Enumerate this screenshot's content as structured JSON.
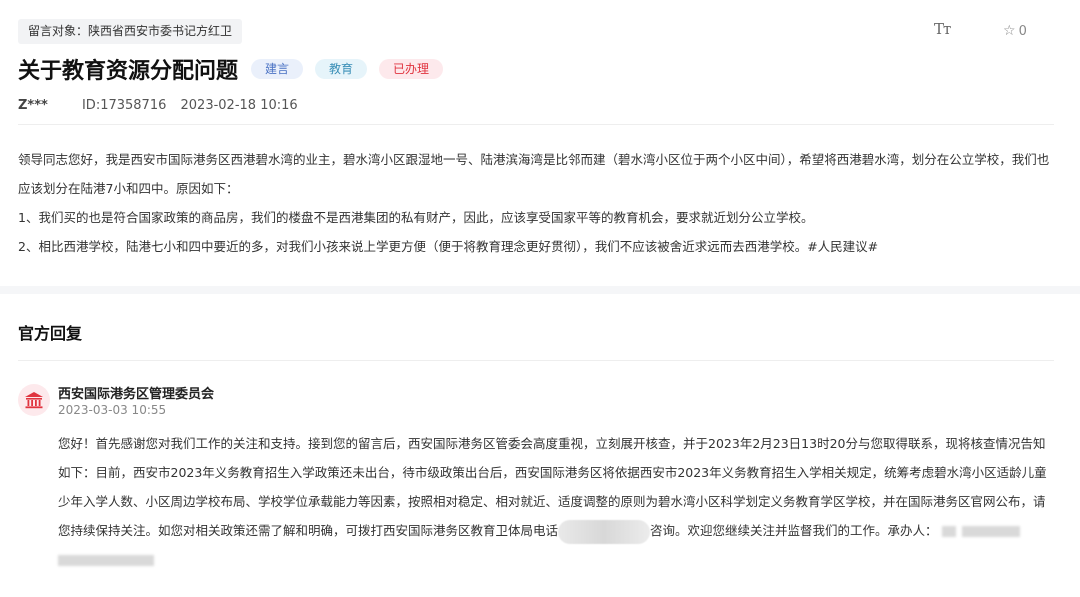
{
  "header": {
    "recipient": "留言对象：陕西省西安市委书记方红卫",
    "font_size_icon": "Tт",
    "star_count": "0"
  },
  "post": {
    "title": "关于教育资源分配问题",
    "tags": [
      "建言",
      "教育",
      "已办理"
    ],
    "author": "Z***",
    "id_text": "ID:17358716",
    "date": "2023-02-18 10:16",
    "paragraphs": [
      "领导同志您好，我是西安市国际港务区西港碧水湾的业主，碧水湾小区跟湿地一号、陆港滨海湾是比邻而建（碧水湾小区位于两个小区中间），希望将西港碧水湾，划分在公立学校，我们也应该划分在陆港7小和四中。原因如下：",
      "1、我们买的也是符合国家政策的商品房，我们的楼盘不是西港集团的私有财产，因此，应该享受国家平等的教育机会，要求就近划分公立学校。",
      "2、相比西港学校，陆港七小和四中要近的多，对我们小孩来说上学更方便（便于将教育理念更好贯彻），我们不应该被舍近求远而去西港学校。#人民建议#"
    ]
  },
  "reply": {
    "section_title": "官方回复",
    "org_name": "西安国际港务区管理委员会",
    "time": "2023-03-03 10:55",
    "text_before_phone": "您好！首先感谢您对我们工作的关注和支持。接到您的留言后，西安国际港务区管委会高度重视，立刻展开核查，并于2023年2月23日13时20分与您取得联系，现将核查情况告知如下：目前，西安市2023年义务教育招生入学政策还未出台，待市级政策出台后，西安国际港务区将依据西安市2023年义务教育招生入学相关规定，统筹考虑碧水湾小区适龄儿童少年入学人数、小区周边学校布局、学校学位承载能力等因素，按照相对稳定、相对就近、适度调整的原则为碧水湾小区科学划定义务教育学区学校，并在国际港务区官网公布，请您持续保持关注。如您对相关政策还需了解和明确，可拨打西安国际港务区教育卫体局电话",
    "text_after_phone": "咨询。欢迎您继续关注并监督我们的工作。承办人："
  },
  "icons": {
    "star": "star-outline-icon",
    "org": "government-building-icon"
  },
  "colors": {
    "tag_suggest": "#4a72c4",
    "tag_edu": "#3a8fb7",
    "tag_done": "#e0343f",
    "org_icon": "#e0343f"
  }
}
